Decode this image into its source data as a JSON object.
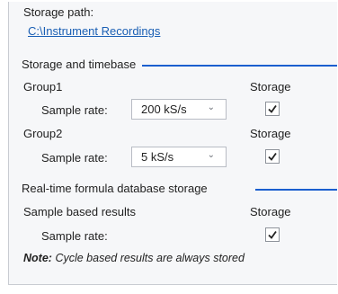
{
  "storage": {
    "path_label": "Storage path:",
    "path_value": "C:\\Instrument Recordings"
  },
  "timebase": {
    "section_title": "Storage and timebase",
    "groups": [
      {
        "name": "Group1",
        "storage_label": "Storage",
        "rate_label": "Sample rate:",
        "rate_value": "200 kS/s",
        "storage_checked": true
      },
      {
        "name": "Group2",
        "storage_label": "Storage",
        "rate_label": "Sample rate:",
        "rate_value": "5 kS/s",
        "storage_checked": true
      }
    ]
  },
  "formula": {
    "section_title": "Real-time formula database storage",
    "sample_results_label": "Sample based results",
    "storage_label": "Storage",
    "rate_label": "Sample rate:",
    "storage_checked": true,
    "note_prefix": "Note:",
    "note_text": "Cycle based results are always stored"
  },
  "colors": {
    "accent": "#1b5fcf",
    "link": "#1a5fb4"
  },
  "icons": {
    "dropdown": "chevron-down-icon",
    "check": "checkmark-icon"
  }
}
